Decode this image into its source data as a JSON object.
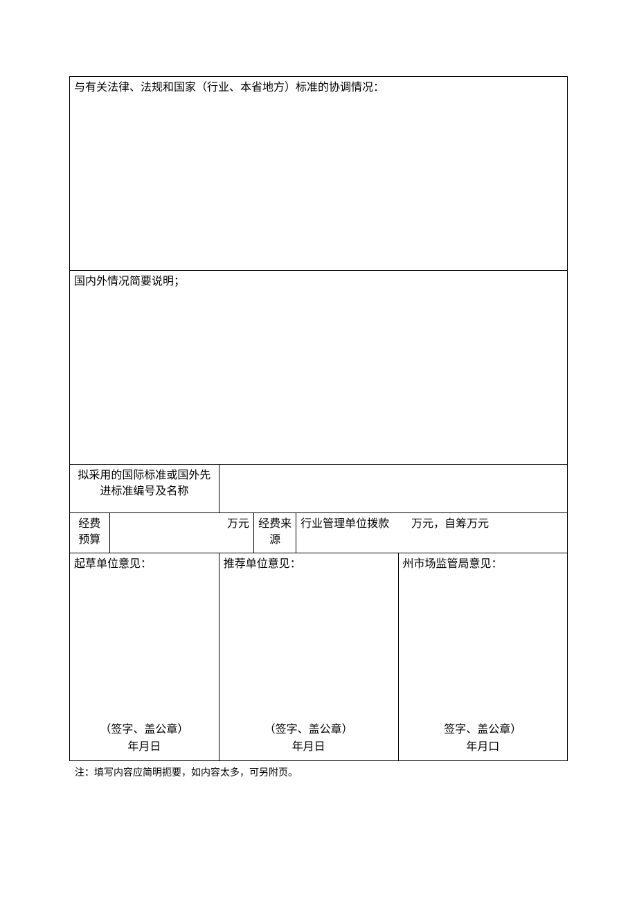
{
  "section1": {
    "title": "与有关法律、法规和国家（行业、本省地方）标准的协调情况："
  },
  "section2": {
    "title": "国内外情况简要说明；"
  },
  "standard_row": {
    "label": "拟采用的国际标准或国外先进标准编号及名称"
  },
  "budget_row": {
    "label": "经费预算",
    "unit": "万元",
    "src_label": "经费来源",
    "src_text": "行业管理单位拨款　　万元，自筹万元"
  },
  "opinions": {
    "draft": {
      "title": "起草单位意见：",
      "sign": "（签字、盖公章）",
      "date": "年月日"
    },
    "recommend": {
      "title": "推荐单位意见：",
      "sign": "（签字、盖公章）",
      "date": "年月日"
    },
    "bureau": {
      "title": "州市场监管局意见：",
      "sign": "签字、盖公章）",
      "date": "年月口"
    }
  },
  "footnote": "注：填写内容应简明扼要，如内容太多，可另附页。"
}
